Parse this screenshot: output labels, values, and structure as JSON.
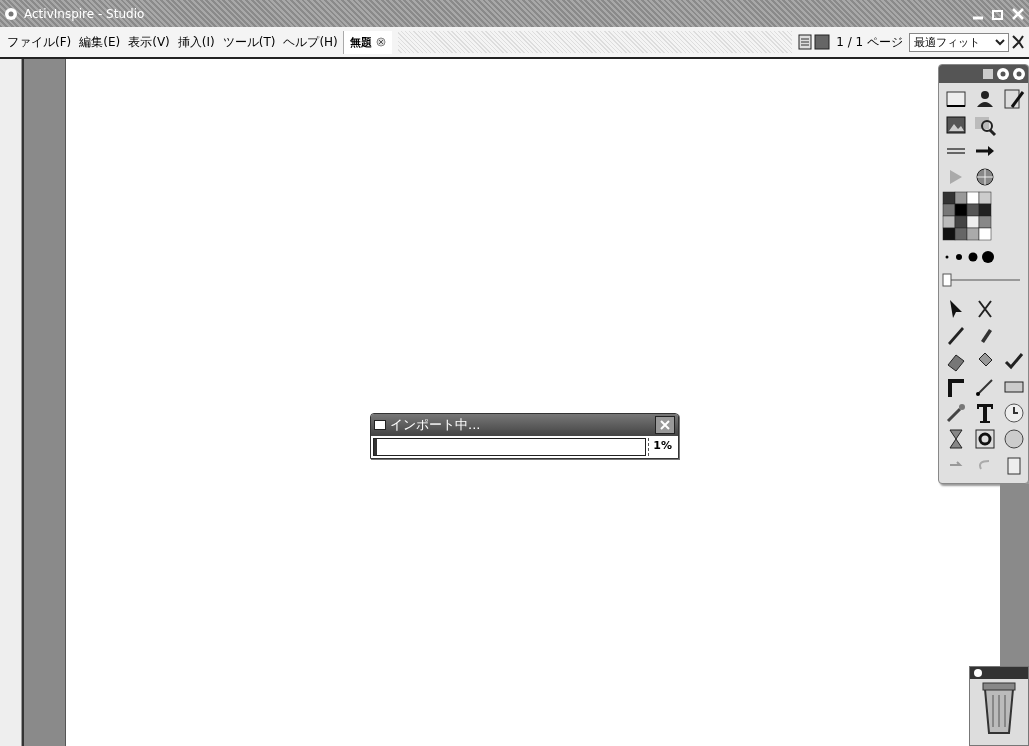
{
  "window": {
    "title": "ActivInspire - Studio"
  },
  "menu": [
    {
      "label": "ファイル(F)"
    },
    {
      "label": "編集(E)"
    },
    {
      "label": "表示(V)"
    },
    {
      "label": "挿入(I)"
    },
    {
      "label": "ツール(T)"
    },
    {
      "label": "ヘルプ(H)"
    }
  ],
  "tabs": [
    {
      "label": "無題",
      "selected": true
    }
  ],
  "page_counter": "1 / 1 ページ",
  "zoom": {
    "value": "最適フィット"
  },
  "dialog": {
    "title": "インポート中...",
    "progress": {
      "level": 0.01,
      "reading": "1%"
    }
  }
}
